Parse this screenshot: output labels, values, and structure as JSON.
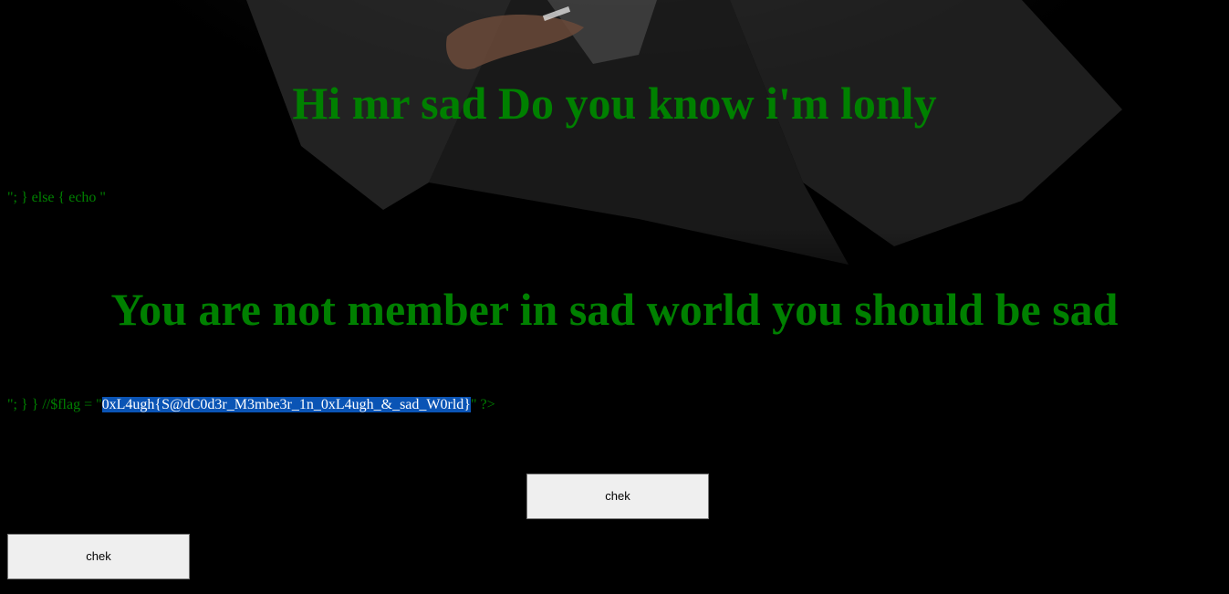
{
  "headings": {
    "greeting": "Hi mr sad Do you know i'm lonly",
    "not_member": "You are not member in sad world you should be sad"
  },
  "code": {
    "line1": "\"; } else { echo \"",
    "line2_prefix": "\"; } } //$flag = \"",
    "line2_flag": "0xL4ugh{S@dC0d3r_M3mbe3r_1n_0xL4ugh_&_sad_W0rld}",
    "line2_suffix": "\" ?>"
  },
  "buttons": {
    "center_label": "chek",
    "left_label": "chek"
  },
  "colors": {
    "text": "#008000",
    "background": "#000000",
    "selection": "#0a54b5"
  }
}
